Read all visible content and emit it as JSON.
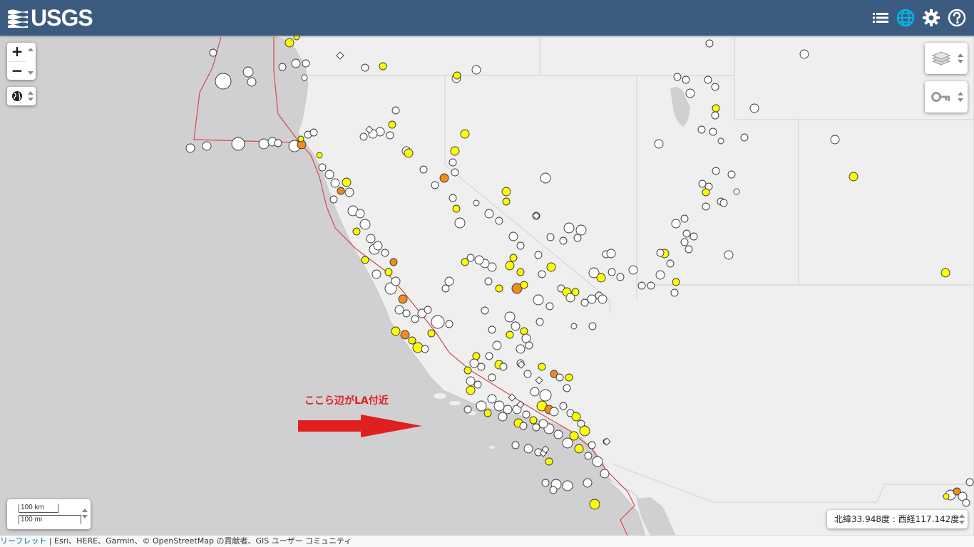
{
  "header": {
    "logo_text": "USGS",
    "icons": [
      "list-icon",
      "globe-icon",
      "gear-icon",
      "help-icon"
    ],
    "background_color": "#3c5b80",
    "active_icon_color": "#00b7e8"
  },
  "controls": {
    "zoom_in_label": "+",
    "zoom_out_label": "−",
    "scale_km": "100 km",
    "scale_mi": "100 mi",
    "coordinates": "北緯33.948度 : 西経117.142度"
  },
  "annotation": {
    "text": "ここら辺がLA付近",
    "color": "#e02020"
  },
  "attribution": {
    "leaflet": "リーフレット",
    "sep": " | ",
    "text": "Esri、HERE、Garmin、© OpenStreetMap の貢献者、GIS ユーザー コミュニティ"
  },
  "legend_colors": {
    "older": "#ffffff",
    "past_week": "#ffff00",
    "past_day": "#f08c1e",
    "plate_boundary": "#d44a4a"
  }
}
